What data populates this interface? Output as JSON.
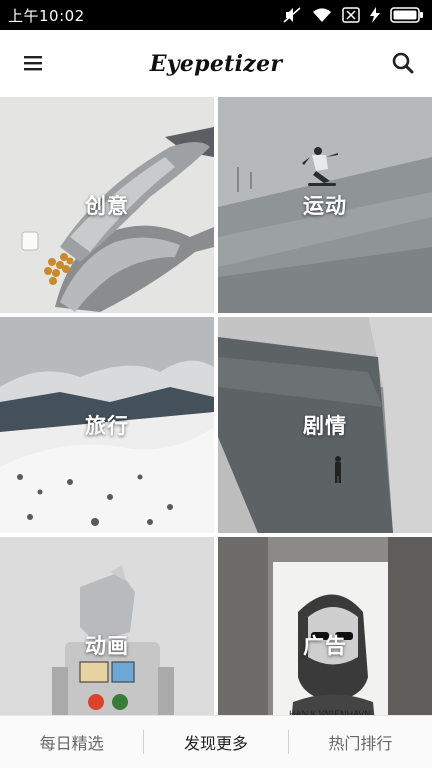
{
  "status_bar": {
    "time": "上午10:02",
    "icons": [
      "mute-icon",
      "wifi-icon",
      "sim-icon",
      "charging-icon",
      "battery-icon"
    ]
  },
  "app_bar": {
    "title": "Eyepetizer",
    "left_icon": "menu-icon",
    "right_icon": "search-icon"
  },
  "categories": [
    {
      "label": "创意"
    },
    {
      "label": "运动"
    },
    {
      "label": "旅行"
    },
    {
      "label": "剧情"
    },
    {
      "label": "动画"
    },
    {
      "label": "广告"
    }
  ],
  "bottom_nav": {
    "items": [
      {
        "label": "每日精选",
        "active": false
      },
      {
        "label": "发现更多",
        "active": true
      },
      {
        "label": "热门排行",
        "active": false
      }
    ]
  }
}
